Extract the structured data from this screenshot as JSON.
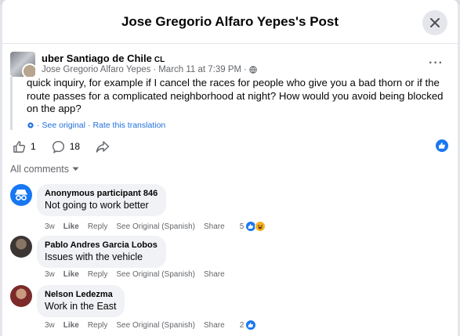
{
  "dialog": {
    "title": "Jose Gregorio Alfaro Yepes's Post"
  },
  "post": {
    "page_name": "uber Santiago de Chile",
    "country_code": "CL",
    "author": "Jose Gregorio Alfaro Yepes",
    "separator": "·",
    "date": "March 11 at 7:39 PM",
    "text": "quick inquiry, for example if I cancel the races for people who give you a bad thorn or if the route passes for a complicated neighborhood at night? How would you avoid being blocked on the app?",
    "see_original": "See original",
    "rate_translation": "Rate this translation",
    "dot": "·",
    "likes": "1",
    "comments": "18"
  },
  "filter": {
    "label": "All comments"
  },
  "comments": [
    {
      "name": "Anonymous participant 846",
      "text": "Not going to work better",
      "time": "3w",
      "like": "Like",
      "reply": "Reply",
      "see_original": "See Original (Spanish)",
      "share": "Share",
      "reaction_count": "5",
      "reactions": [
        "like-icon",
        "haha-icon"
      ]
    },
    {
      "name": "Pablo Andres Garcia Lobos",
      "text": "Issues with the vehicle",
      "time": "3w",
      "like": "Like",
      "reply": "Reply",
      "see_original": "See Original (Spanish)",
      "share": "Share"
    },
    {
      "name": "Nelson Ledezma",
      "text": "Work in the East",
      "time": "3w",
      "like": "Like",
      "reply": "Reply",
      "see_original": "See Original (Spanish)",
      "share": "Share",
      "reaction_count": "2",
      "reactions": [
        "like-icon"
      ]
    }
  ],
  "colors": {
    "accent": "#1877f2",
    "link": "#216fdb",
    "muted": "#65676b",
    "bubble": "#f0f2f5"
  }
}
